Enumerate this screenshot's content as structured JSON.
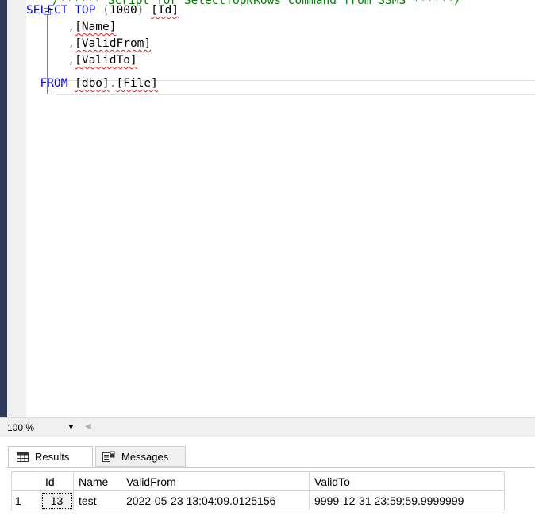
{
  "editor": {
    "comment_line": "/****** Script for SelectTopNRows command from SSMS ******/",
    "lines": [
      [
        {
          "t": "SELECT",
          "c": "kw"
        },
        {
          "t": " TOP ",
          "c": "kw"
        },
        {
          "t": "(",
          "c": "punc"
        },
        {
          "t": "1000",
          "c": "num"
        },
        {
          "t": ") ",
          "c": "punc"
        },
        {
          "t": "[Id]",
          "c": "ident"
        }
      ],
      [
        {
          "t": "      ,",
          "c": "punc"
        },
        {
          "t": "[Name]",
          "c": "ident"
        }
      ],
      [
        {
          "t": "      ,",
          "c": "punc"
        },
        {
          "t": "[ValidFrom]",
          "c": "ident"
        }
      ],
      [
        {
          "t": "      ,",
          "c": "punc"
        },
        {
          "t": "[ValidTo]",
          "c": "ident"
        }
      ],
      [
        {
          "t": "  FROM ",
          "c": "kw"
        },
        {
          "t": "[dbo]",
          "c": "ident"
        },
        {
          "t": ".",
          "c": "punc"
        },
        {
          "t": "[File]",
          "c": "ident"
        }
      ]
    ]
  },
  "zoom": {
    "value": "100 %"
  },
  "tabs": {
    "results": "Results",
    "messages": "Messages"
  },
  "grid": {
    "columns": [
      "Id",
      "Name",
      "ValidFrom",
      "ValidTo"
    ],
    "rows": [
      {
        "rownum": "1",
        "cells": [
          "13",
          "test",
          "2022-05-23 13:04:09.0125156",
          "9999-12-31 23:59:59.9999999"
        ]
      }
    ]
  }
}
